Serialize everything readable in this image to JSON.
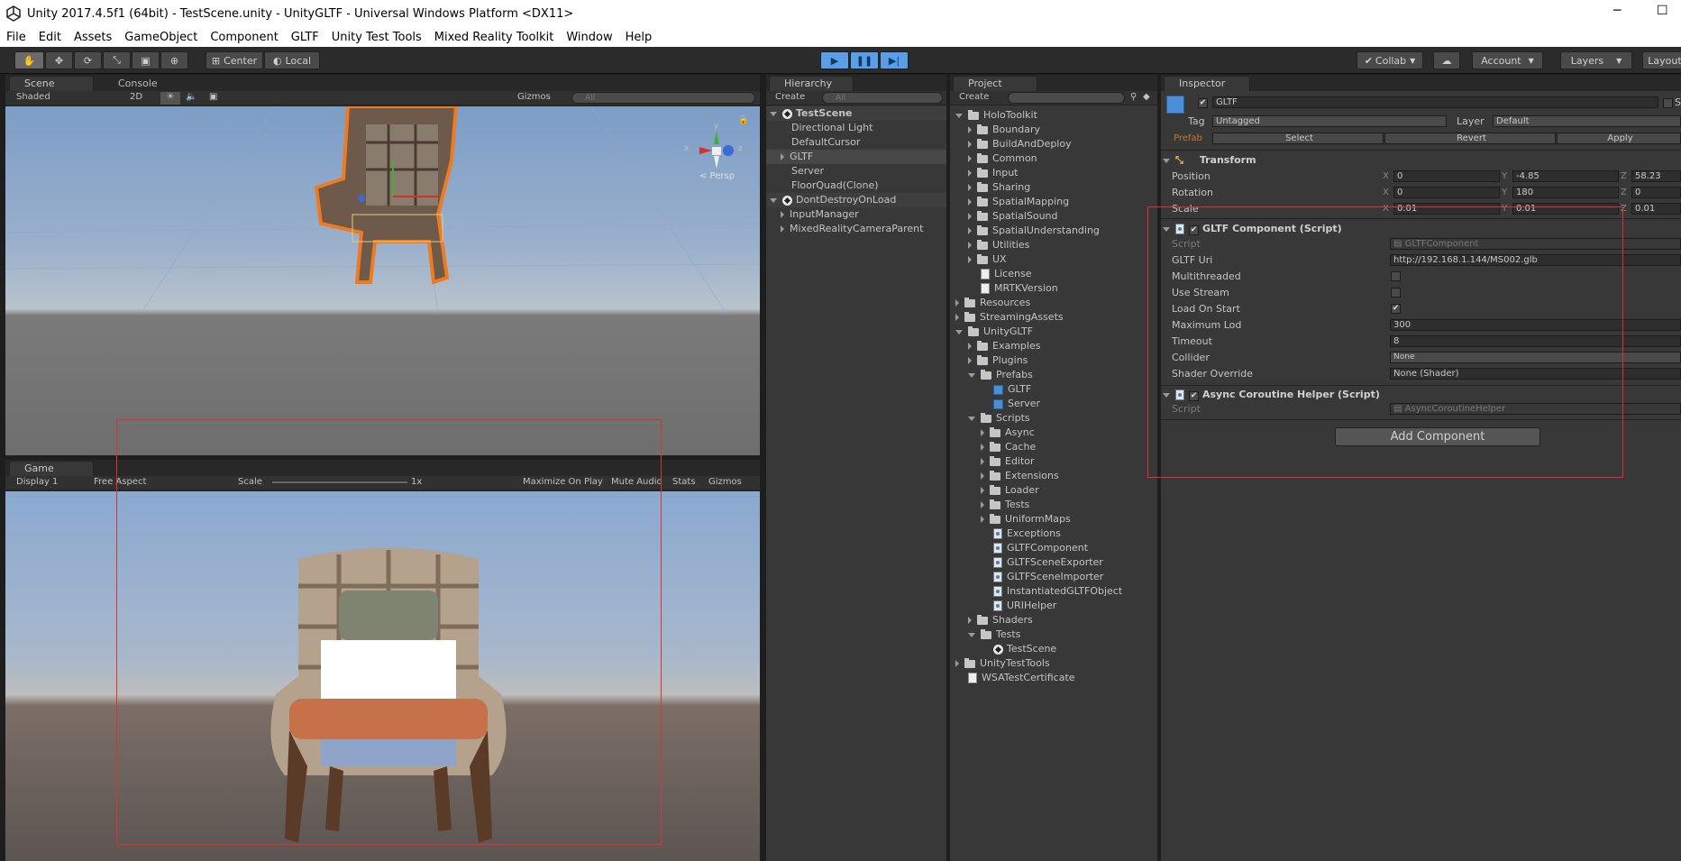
{
  "window": {
    "title": "Unity 2017.4.5f1 (64bit) - TestScene.unity - UnityGLTF - Universal Windows Platform <DX11>"
  },
  "menu": [
    "File",
    "Edit",
    "Assets",
    "GameObject",
    "Component",
    "GLTF",
    "Unity Test Tools",
    "Mixed Reality Toolkit",
    "Window",
    "Help"
  ],
  "toolbar": {
    "pivot": "Center",
    "space": "Local",
    "collab": "Collab",
    "account": "Account",
    "layers": "Layers",
    "layout": "Layout"
  },
  "scene": {
    "tab": "Scene",
    "tab2": "Console",
    "shading": "Shaded",
    "mode2d": "2D",
    "gizmos": "Gizmos",
    "search": "All",
    "persp": "< Persp",
    "axis_x": "x",
    "axis_y": "y",
    "axis_z": "z"
  },
  "game": {
    "tab": "Game",
    "display": "Display 1",
    "aspect": "Free Aspect",
    "scale_label": "Scale",
    "scale_value": "1x",
    "maximize": "Maximize On Play",
    "mute": "Mute Audio",
    "stats": "Stats",
    "gizmos": "Gizmos"
  },
  "hierarchy": {
    "tab": "Hierarchy",
    "create": "Create",
    "search": "All",
    "scene": "TestScene",
    "items": [
      "Directional Light",
      "DefaultCursor",
      "GLTF",
      "Server",
      "FloorQuad(Clone)"
    ],
    "dontdestroy": "DontDestroyOnLoad",
    "dd_items": [
      "InputManager",
      "MixedRealityCameraParent"
    ]
  },
  "project": {
    "tab": "Project",
    "create": "Create",
    "items": [
      {
        "label": "HoloToolkit",
        "depth": 0,
        "kind": "folder",
        "open": true
      },
      {
        "label": "Boundary",
        "depth": 1,
        "kind": "folder"
      },
      {
        "label": "BuildAndDeploy",
        "depth": 1,
        "kind": "folder"
      },
      {
        "label": "Common",
        "depth": 1,
        "kind": "folder"
      },
      {
        "label": "Input",
        "depth": 1,
        "kind": "folder"
      },
      {
        "label": "Sharing",
        "depth": 1,
        "kind": "folder"
      },
      {
        "label": "SpatialMapping",
        "depth": 1,
        "kind": "folder"
      },
      {
        "label": "SpatialSound",
        "depth": 1,
        "kind": "folder"
      },
      {
        "label": "SpatialUnderstanding",
        "depth": 1,
        "kind": "folder"
      },
      {
        "label": "Utilities",
        "depth": 1,
        "kind": "folder"
      },
      {
        "label": "UX",
        "depth": 1,
        "kind": "folder"
      },
      {
        "label": "License",
        "depth": 1,
        "kind": "doc"
      },
      {
        "label": "MRTKVersion",
        "depth": 1,
        "kind": "doc"
      },
      {
        "label": "Resources",
        "depth": 0,
        "kind": "folder"
      },
      {
        "label": "StreamingAssets",
        "depth": 0,
        "kind": "folder"
      },
      {
        "label": "UnityGLTF",
        "depth": 0,
        "kind": "folder",
        "open": true
      },
      {
        "label": "Examples",
        "depth": 1,
        "kind": "folder"
      },
      {
        "label": "Plugins",
        "depth": 1,
        "kind": "folder"
      },
      {
        "label": "Prefabs",
        "depth": 1,
        "kind": "folder",
        "open": true
      },
      {
        "label": "GLTF",
        "depth": 2,
        "kind": "prefab"
      },
      {
        "label": "Server",
        "depth": 2,
        "kind": "prefab"
      },
      {
        "label": "Scripts",
        "depth": 1,
        "kind": "folder",
        "open": true
      },
      {
        "label": "Async",
        "depth": 2,
        "kind": "folder"
      },
      {
        "label": "Cache",
        "depth": 2,
        "kind": "folder"
      },
      {
        "label": "Editor",
        "depth": 2,
        "kind": "folder"
      },
      {
        "label": "Extensions",
        "depth": 2,
        "kind": "folder"
      },
      {
        "label": "Loader",
        "depth": 2,
        "kind": "folder"
      },
      {
        "label": "Tests",
        "depth": 2,
        "kind": "folder"
      },
      {
        "label": "UniformMaps",
        "depth": 2,
        "kind": "folder"
      },
      {
        "label": "Exceptions",
        "depth": 2,
        "kind": "cs"
      },
      {
        "label": "GLTFComponent",
        "depth": 2,
        "kind": "cs"
      },
      {
        "label": "GLTFSceneExporter",
        "depth": 2,
        "kind": "cs"
      },
      {
        "label": "GLTFSceneImporter",
        "depth": 2,
        "kind": "cs"
      },
      {
        "label": "InstantiatedGLTFObject",
        "depth": 2,
        "kind": "cs"
      },
      {
        "label": "URIHelper",
        "depth": 2,
        "kind": "cs"
      },
      {
        "label": "Shaders",
        "depth": 1,
        "kind": "folder"
      },
      {
        "label": "Tests",
        "depth": 1,
        "kind": "folder",
        "open": true
      },
      {
        "label": "TestScene",
        "depth": 2,
        "kind": "unity"
      },
      {
        "label": "UnityTestTools",
        "depth": 0,
        "kind": "folder"
      },
      {
        "label": "WSATestCertificate",
        "depth": 0,
        "kind": "cert"
      }
    ]
  },
  "inspector": {
    "tab": "Inspector",
    "name": "GLTF",
    "static": "S",
    "tag_label": "Tag",
    "tag": "Untagged",
    "layer_label": "Layer",
    "layer": "Default",
    "prefab": "Prefab",
    "select": "Select",
    "revert": "Revert",
    "apply": "Apply",
    "transform": {
      "title": "Transform",
      "position_label": "Position",
      "position": [
        "0",
        "-4.85",
        "58.23"
      ],
      "rotation_label": "Rotation",
      "rotation": [
        "0",
        "180",
        "0"
      ],
      "scale_label": "Scale",
      "scale": [
        "0.01",
        "0.01",
        "0.01"
      ],
      "axes": [
        "X",
        "Y",
        "Z"
      ]
    },
    "gltf": {
      "title": "GLTF Component (Script)",
      "script_label": "Script",
      "script": "GLTFComponent",
      "uri_label": "GLTF Uri",
      "uri": "http://192.168.1.144/MS002.glb",
      "multithreaded_label": "Multithreaded",
      "multithreaded": false,
      "usestream_label": "Use Stream",
      "usestream": false,
      "loadonstart_label": "Load On Start",
      "loadonstart": true,
      "maxlod_label": "Maximum Lod",
      "maxlod": "300",
      "timeout_label": "Timeout",
      "timeout": "8",
      "collider_label": "Collider",
      "collider": "None",
      "shader_label": "Shader Override",
      "shader": "None (Shader)"
    },
    "async": {
      "title": "Async Coroutine Helper (Script)",
      "script_label": "Script",
      "script": "AsyncCoroutineHelper"
    },
    "add_component": "Add Component"
  }
}
